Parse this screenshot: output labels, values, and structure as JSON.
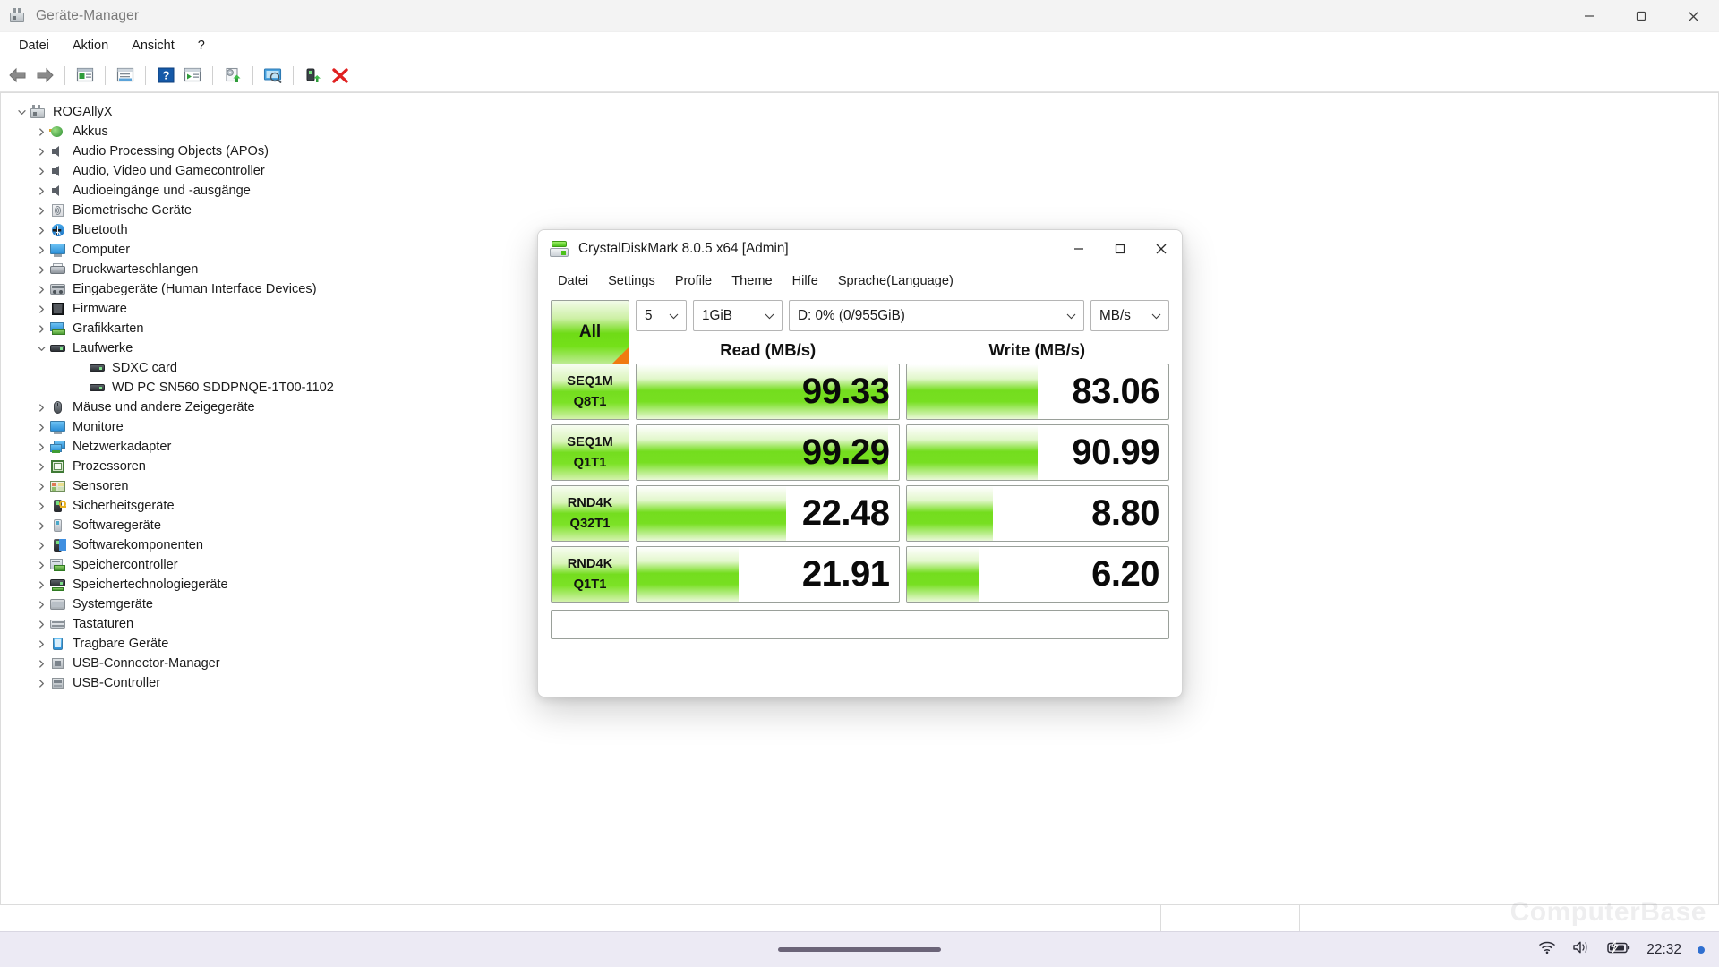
{
  "device_manager": {
    "title": "Geräte-Manager",
    "title_icon": "device-manager-icon",
    "caption": {
      "minimize": "minimize-icon",
      "maximize": "maximize-icon",
      "close": "close-icon"
    },
    "menu": [
      {
        "label": "Datei"
      },
      {
        "label": "Aktion"
      },
      {
        "label": "Ansicht"
      },
      {
        "label": "?"
      }
    ],
    "toolbar": [
      {
        "name": "back-icon"
      },
      {
        "name": "forward-icon"
      },
      {
        "name": "separator"
      },
      {
        "name": "properties-icon"
      },
      {
        "name": "separator"
      },
      {
        "name": "show-hidden-icon"
      },
      {
        "name": "separator"
      },
      {
        "name": "help-icon"
      },
      {
        "name": "scan-hardware-icon"
      },
      {
        "name": "separator"
      },
      {
        "name": "update-driver-icon"
      },
      {
        "name": "separator"
      },
      {
        "name": "remote-computer-icon"
      },
      {
        "name": "separator"
      },
      {
        "name": "enable-device-icon"
      },
      {
        "name": "uninstall-device-icon"
      }
    ],
    "tree": [
      {
        "label": "ROGAllyX",
        "level": 0,
        "expanded": true,
        "icon": "computer-root-icon"
      },
      {
        "label": "Akkus",
        "level": 1,
        "expanded": false,
        "icon": "battery-icon"
      },
      {
        "label": "Audio Processing Objects (APOs)",
        "level": 1,
        "expanded": false,
        "icon": "speaker-icon"
      },
      {
        "label": "Audio, Video und Gamecontroller",
        "level": 1,
        "expanded": false,
        "icon": "speaker-icon"
      },
      {
        "label": "Audioeingänge und -ausgänge",
        "level": 1,
        "expanded": false,
        "icon": "speaker-icon"
      },
      {
        "label": "Biometrische Geräte",
        "level": 1,
        "expanded": false,
        "icon": "fingerprint-icon"
      },
      {
        "label": "Bluetooth",
        "level": 1,
        "expanded": false,
        "icon": "bluetooth-icon"
      },
      {
        "label": "Computer",
        "level": 1,
        "expanded": false,
        "icon": "monitor-icon"
      },
      {
        "label": "Druckwarteschlangen",
        "level": 1,
        "expanded": false,
        "icon": "printer-icon"
      },
      {
        "label": "Eingabegeräte (Human Interface Devices)",
        "level": 1,
        "expanded": false,
        "icon": "hid-icon"
      },
      {
        "label": "Firmware",
        "level": 1,
        "expanded": false,
        "icon": "firmware-icon"
      },
      {
        "label": "Grafikkarten",
        "level": 1,
        "expanded": false,
        "icon": "gpu-icon"
      },
      {
        "label": "Laufwerke",
        "level": 1,
        "expanded": true,
        "icon": "drive-icon"
      },
      {
        "label": "SDXC card",
        "level": 2,
        "expanded": null,
        "icon": "drive-icon"
      },
      {
        "label": "WD PC SN560 SDDPNQE-1T00-1102",
        "level": 2,
        "expanded": null,
        "icon": "drive-icon"
      },
      {
        "label": "Mäuse und andere Zeigegeräte",
        "level": 1,
        "expanded": false,
        "icon": "mouse-icon"
      },
      {
        "label": "Monitore",
        "level": 1,
        "expanded": false,
        "icon": "monitor-icon"
      },
      {
        "label": "Netzwerkadapter",
        "level": 1,
        "expanded": false,
        "icon": "network-icon"
      },
      {
        "label": "Prozessoren",
        "level": 1,
        "expanded": false,
        "icon": "cpu-icon"
      },
      {
        "label": "Sensoren",
        "level": 1,
        "expanded": false,
        "icon": "sensor-icon"
      },
      {
        "label": "Sicherheitsgeräte",
        "level": 1,
        "expanded": false,
        "icon": "security-device-icon"
      },
      {
        "label": "Softwaregeräte",
        "level": 1,
        "expanded": false,
        "icon": "software-device-icon"
      },
      {
        "label": "Softwarekomponenten",
        "level": 1,
        "expanded": false,
        "icon": "software-component-icon"
      },
      {
        "label": "Speichercontroller",
        "level": 1,
        "expanded": false,
        "icon": "storage-controller-icon"
      },
      {
        "label": "Speichertechnologiegeräte",
        "level": 1,
        "expanded": false,
        "icon": "storage-tech-icon"
      },
      {
        "label": "Systemgeräte",
        "level": 1,
        "expanded": false,
        "icon": "system-device-icon"
      },
      {
        "label": "Tastaturen",
        "level": 1,
        "expanded": false,
        "icon": "keyboard-icon"
      },
      {
        "label": "Tragbare Geräte",
        "level": 1,
        "expanded": false,
        "icon": "portable-device-icon"
      },
      {
        "label": "USB-Connector-Manager",
        "level": 1,
        "expanded": false,
        "icon": "usb-connector-icon"
      },
      {
        "label": "USB-Controller",
        "level": 1,
        "expanded": false,
        "icon": "usb-controller-icon"
      }
    ]
  },
  "crystaldiskmark": {
    "title": "CrystalDiskMark 8.0.5 x64 [Admin]",
    "title_icon": "crystaldiskmark-icon",
    "caption": {
      "minimize": "minimize-icon",
      "maximize": "maximize-icon",
      "close": "close-icon"
    },
    "menu": [
      {
        "label": "Datei"
      },
      {
        "label": "Settings"
      },
      {
        "label": "Profile"
      },
      {
        "label": "Theme"
      },
      {
        "label": "Hilfe"
      },
      {
        "label": "Sprache(Language)"
      }
    ],
    "controls": {
      "all_button": "All",
      "runs": "5",
      "size": "1GiB",
      "drive": "D: 0% (0/955GiB)",
      "unit": "MB/s"
    },
    "columns": {
      "read": "Read (MB/s)",
      "write": "Write (MB/s)"
    },
    "status_text": "",
    "chart_data": {
      "type": "bar",
      "title": "CrystalDiskMark 8.0.5 benchmark results",
      "unit": "MB/s",
      "drive": "D: 0% (0/955GiB)",
      "test_runs": 5,
      "test_size": "1GiB",
      "categories": [
        "SEQ1M Q8T1",
        "SEQ1M Q1T1",
        "RND4K Q32T1",
        "RND4K Q1T1"
      ],
      "series": [
        {
          "name": "Read (MB/s)",
          "values": [
            99.33,
            99.29,
            22.48,
            21.91
          ]
        },
        {
          "name": "Write (MB/s)",
          "values": [
            83.06,
            90.99,
            8.8,
            6.2
          ]
        }
      ],
      "rows": [
        {
          "name_line1": "SEQ1M",
          "name_line2": "Q8T1",
          "read": "99.33",
          "write": "83.06",
          "read_fill_pct": 96,
          "write_fill_pct": 50
        },
        {
          "name_line1": "SEQ1M",
          "name_line2": "Q1T1",
          "read": "99.29",
          "write": "90.99",
          "read_fill_pct": 96,
          "write_fill_pct": 50
        },
        {
          "name_line1": "RND4K",
          "name_line2": "Q32T1",
          "read": "22.48",
          "write": "8.80",
          "read_fill_pct": 57,
          "write_fill_pct": 33
        },
        {
          "name_line1": "RND4K",
          "name_line2": "Q1T1",
          "read": "21.91",
          "write": "6.20",
          "read_fill_pct": 39,
          "write_fill_pct": 28
        }
      ],
      "xlabel": "",
      "ylabel": "MB/s",
      "legend_position": "top"
    }
  },
  "taskbar": {
    "wifi_icon": "wifi-icon",
    "volume_icon": "volume-icon",
    "battery_icon": "battery-charging-icon",
    "clock": "22:32",
    "notification_dot": "notification-dot"
  },
  "watermark": {
    "text": "ComputerBase"
  },
  "colors": {
    "accent_green": "#74dd1e",
    "accent_orange": "#f07a10",
    "taskbar_bg": "#eceaf4",
    "title_text": "#7a7a7a"
  }
}
